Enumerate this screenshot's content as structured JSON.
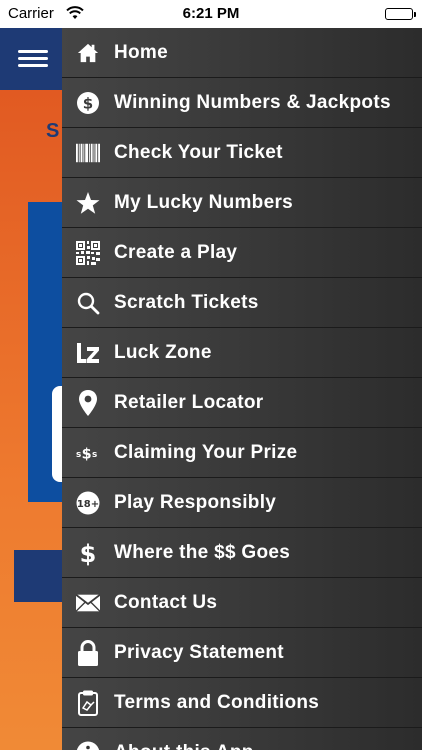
{
  "status_bar": {
    "carrier": "Carrier",
    "time": "6:21 PM",
    "battery_level": 1.0
  },
  "background": {
    "partial_text": "S",
    "colors": {
      "header": "#1e3a75",
      "body_orange": "#ee7a2f",
      "panel_blue": "#0d4ea0"
    }
  },
  "drawer": {
    "items": [
      {
        "label": "Home",
        "icon": "home-icon"
      },
      {
        "label": "Winning Numbers & Jackpots",
        "icon": "dollar-circle-icon"
      },
      {
        "label": "Check Your Ticket",
        "icon": "barcode-icon"
      },
      {
        "label": "My Lucky Numbers",
        "icon": "star-icon"
      },
      {
        "label": "Create a Play",
        "icon": "qr-code-icon"
      },
      {
        "label": "Scratch Tickets",
        "icon": "search-icon"
      },
      {
        "label": "Luck Zone",
        "icon": "lz-logo-icon"
      },
      {
        "label": "Retailer Locator",
        "icon": "map-pin-icon"
      },
      {
        "label": "Claiming Your Prize",
        "icon": "money-symbols-icon"
      },
      {
        "label": "Play Responsibly",
        "icon": "age-18-plus-icon"
      },
      {
        "label": "Where the $$ Goes",
        "icon": "dollar-sign-icon"
      },
      {
        "label": "Contact Us",
        "icon": "envelope-icon"
      },
      {
        "label": "Privacy Statement",
        "icon": "lock-icon"
      },
      {
        "label": "Terms and Conditions",
        "icon": "clipboard-icon"
      },
      {
        "label": "About this App",
        "icon": "info-icon"
      }
    ]
  }
}
